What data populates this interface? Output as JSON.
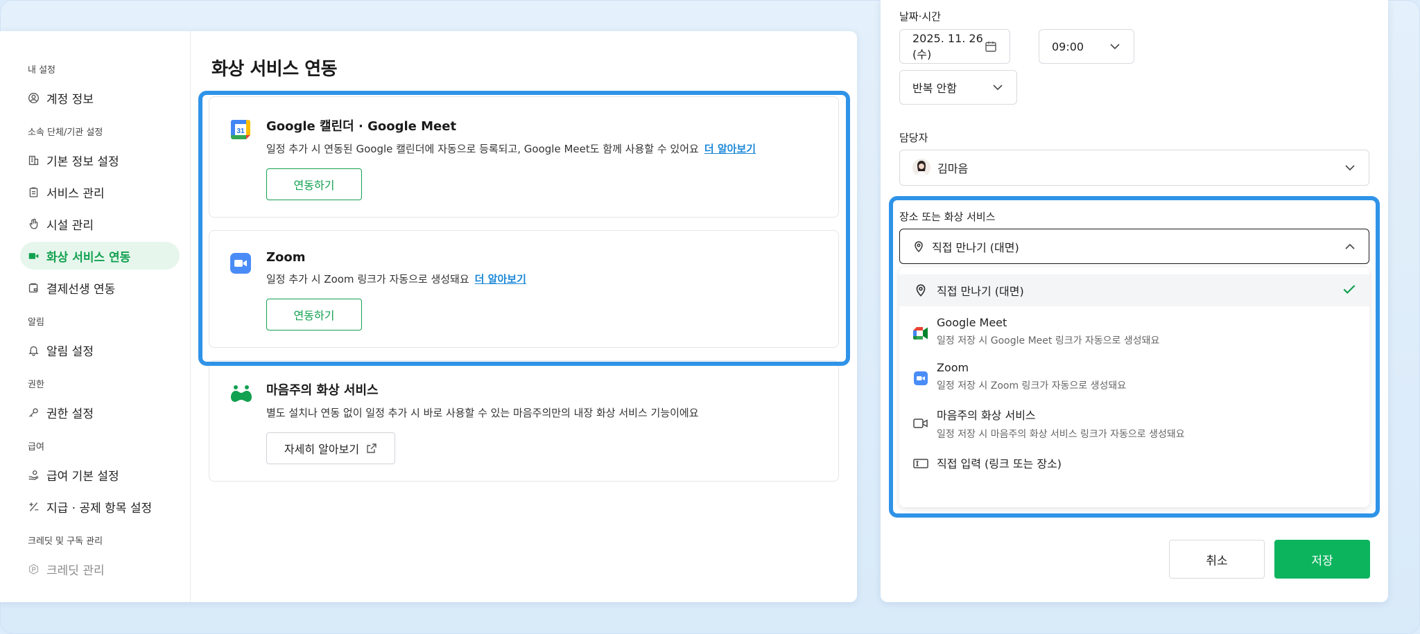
{
  "sidebar": {
    "groups": [
      {
        "head": "내 설정",
        "items": [
          {
            "label": "계정 정보",
            "icon": "user-circle-icon"
          }
        ]
      },
      {
        "head": "소속 단체/기관 설정",
        "items": [
          {
            "label": "기본 정보 설정",
            "icon": "building-icon"
          },
          {
            "label": "서비스 관리",
            "icon": "clipboard-icon"
          },
          {
            "label": "시설 관리",
            "icon": "hand-icon"
          },
          {
            "label": "화상 서비스 연동",
            "icon": "video-camera-icon",
            "active": true
          },
          {
            "label": "결제선생 연동",
            "icon": "payment-icon"
          }
        ]
      },
      {
        "head": "알림",
        "items": [
          {
            "label": "알림 설정",
            "icon": "bell-icon"
          }
        ]
      },
      {
        "head": "권한",
        "items": [
          {
            "label": "권한 설정",
            "icon": "key-icon"
          }
        ]
      },
      {
        "head": "급여",
        "items": [
          {
            "label": "급여 기본 설정",
            "icon": "hand-coin-icon"
          },
          {
            "label": "지급 · 공제 항목 설정",
            "icon": "plus-minus-icon"
          }
        ]
      },
      {
        "head": "크레딧 및 구독 관리",
        "items": [
          {
            "label": "크레딧 관리",
            "icon": "credit-p-icon",
            "muted": true
          }
        ]
      }
    ]
  },
  "main": {
    "title": "화상 서비스 연동",
    "cards": [
      {
        "title": "Google 캘린더 · Google Meet",
        "desc": "일정 추가 시 연동된 Google 캘린더에 자동으로 등록되고, Google Meet도 함께 사용할 수 있어요",
        "link": "더 알아보기",
        "button": "연동하기"
      },
      {
        "title": "Zoom",
        "desc": "일정 추가 시 Zoom 링크가 자동으로 생성돼요",
        "link": "더 알아보기",
        "button": "연동하기"
      },
      {
        "title": "마음주의 화상 서비스",
        "desc": "별도 설치나 연동 없이 일정 추가 시 바로 사용할 수 있는 마음주의만의 내장 화상 서비스 기능이에요",
        "button": "자세히 알아보기"
      }
    ]
  },
  "panel": {
    "datetime_label": "날짜·시간",
    "date": "2025. 11. 26 (수)",
    "time": "09:00",
    "repeat": "반복 안함",
    "assignee_label": "담당자",
    "assignee": "김마음",
    "location_label": "장소 또는 화상 서비스",
    "location_selected": "직접 만나기 (대면)",
    "options": [
      {
        "title": "직접 만나기 (대면)",
        "sub": ""
      },
      {
        "title": "Google Meet",
        "sub": "일정 저장 시 Google Meet 링크가 자동으로 생성돼요"
      },
      {
        "title": "Zoom",
        "sub": "일정 저장 시 Zoom 링크가 자동으로 생성돼요"
      },
      {
        "title": "마음주의 화상 서비스",
        "sub": "일정 저장 시 마음주의 화상 서비스 링크가 자동으로 생성돼요"
      },
      {
        "title": "직접 입력 (링크 또는 장소)",
        "sub": ""
      }
    ],
    "cancel": "취소",
    "save": "저장"
  },
  "colors": {
    "accent_green": "#12a150",
    "save_green": "#0db45e",
    "highlight_blue": "#2f93e8",
    "link_blue": "#1b88d8"
  }
}
